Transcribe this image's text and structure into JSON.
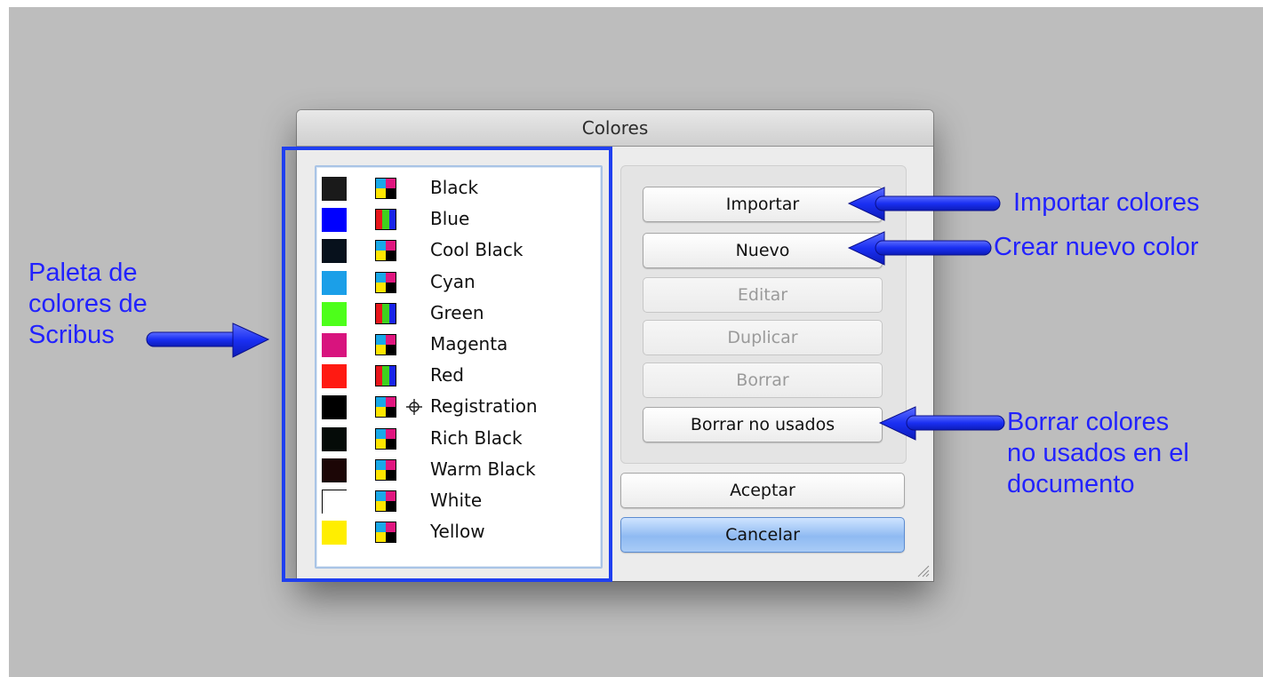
{
  "dialog": {
    "title": "Colores",
    "colors": [
      {
        "name": "Black",
        "hex": "#1a1a1a",
        "model": "cmyk"
      },
      {
        "name": "Blue",
        "hex": "#0000ff",
        "model": "rgb"
      },
      {
        "name": "Cool Black",
        "hex": "#07111c",
        "model": "cmyk"
      },
      {
        "name": "Cyan",
        "hex": "#1b9fe8",
        "model": "cmyk"
      },
      {
        "name": "Green",
        "hex": "#4dff1a",
        "model": "rgb"
      },
      {
        "name": "Magenta",
        "hex": "#d8147e",
        "model": "cmyk"
      },
      {
        "name": "Red",
        "hex": "#ff1a12",
        "model": "rgb"
      },
      {
        "name": "Registration",
        "hex": "#000000",
        "model": "cmyk",
        "registration": true
      },
      {
        "name": "Rich Black",
        "hex": "#050b08",
        "model": "cmyk"
      },
      {
        "name": "Warm Black",
        "hex": "#1c0606",
        "model": "cmyk"
      },
      {
        "name": "White",
        "hex": "#ffffff",
        "model": "cmyk"
      },
      {
        "name": "Yellow",
        "hex": "#ffee00",
        "model": "cmyk"
      }
    ],
    "buttons": {
      "importar": "Importar",
      "nuevo": "Nuevo",
      "editar": "Editar",
      "duplicar": "Duplicar",
      "borrar": "Borrar",
      "borrar_no_usados": "Borrar no usados",
      "aceptar": "Aceptar",
      "cancelar": "Cancelar"
    }
  },
  "annotations": {
    "palette_lines": [
      "Paleta de",
      "colores de",
      "Scribus"
    ],
    "importar": "Importar colores",
    "nuevo": "Crear nuevo color",
    "borrar_lines": [
      "Borrar colores",
      "no usados en el",
      "documento"
    ]
  },
  "colors": {
    "annotation_blue": "#2222ff",
    "backdrop": "#bdbdbd"
  }
}
